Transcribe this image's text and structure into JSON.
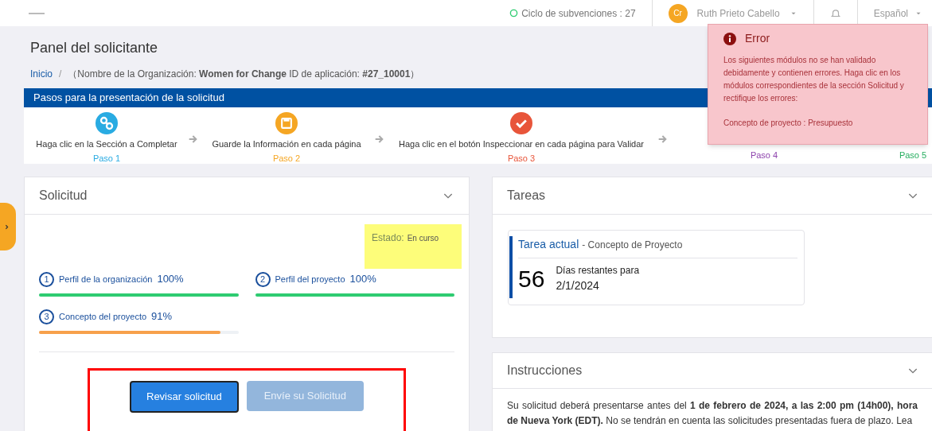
{
  "top_bar": {
    "cycle": "Ciclo de subvenciones : 27",
    "user_initials": "Cr",
    "user_name": "Ruth Prieto Cabello",
    "language": "Español"
  },
  "page_title": "Panel del solicitante",
  "breadcrumb": {
    "home": "Inicio",
    "separator": "/",
    "details": "（Nombre de la Organización: **Women for Change**  ID de aplicación: **#27_10001**）"
  },
  "steps_panel": {
    "title": "Pasos para la presentación de la solicitud",
    "steps": [
      {
        "kind": "link",
        "text": "Haga clic en la Sección a Completar",
        "label": "Paso 1",
        "color": "#29abe2"
      },
      {
        "kind": "save",
        "text": "Guarde la Información en cada página",
        "label": "Paso 2",
        "color": "#f5a623"
      },
      {
        "kind": "check",
        "text": "Haga clic en el botón Inspeccionar en cada página para Validar",
        "label": "Paso 3",
        "color": "#e8553a"
      },
      {
        "kind": "hidden",
        "label": "Paso 4",
        "color": "#8e44ad"
      },
      {
        "kind": "hidden",
        "label": "Paso 5",
        "color": "#27ae60"
      }
    ]
  },
  "error_popup": {
    "title": "Error",
    "message": "Los siguientes módulos no se han validado debidamente y contienen errores. Haga clic en los módulos correspondientes de la sección Solicitud y rectifique los errores:",
    "detail": "Concepto de proyecto : Presupuesto"
  },
  "application_card": {
    "title": "Solicitud",
    "status_label": "Estado:",
    "status_value": "En curso",
    "modules": [
      {
        "number": "1",
        "name": "Perfil de la organización",
        "percent": "100%",
        "level": 1,
        "color": "#2ecc71"
      },
      {
        "number": "2",
        "name": "Perfil del proyecto",
        "percent": "100%",
        "level": 1,
        "color": "#2ecc71"
      },
      {
        "number": "3",
        "name": "Concepto del proyecto",
        "percent": "91%",
        "level": 0.91,
        "color": "#f7a04b"
      }
    ],
    "buttons": [
      {
        "label": "Revisar solicitud",
        "disabled": false
      },
      {
        "label": "Envíe su Solicitud",
        "disabled": true
      }
    ]
  },
  "tasks_card": {
    "title": "Tareas",
    "current_label": "Tarea actual",
    "current_task": "- Concepto de Proyecto",
    "days": "56",
    "days_text": "Días restantes para",
    "due_date": "2/1/2024"
  },
  "instructions_card": {
    "title": "Instrucciones",
    "text": "Su solicitud deberá presentarse antes del **1 de febrero de 2024, a las 2:00 pm (14h00), hora de Nueva York (EDT).** No se tendrán en cuenta las solicitudes presentadas fuera de plazo. Lea"
  }
}
